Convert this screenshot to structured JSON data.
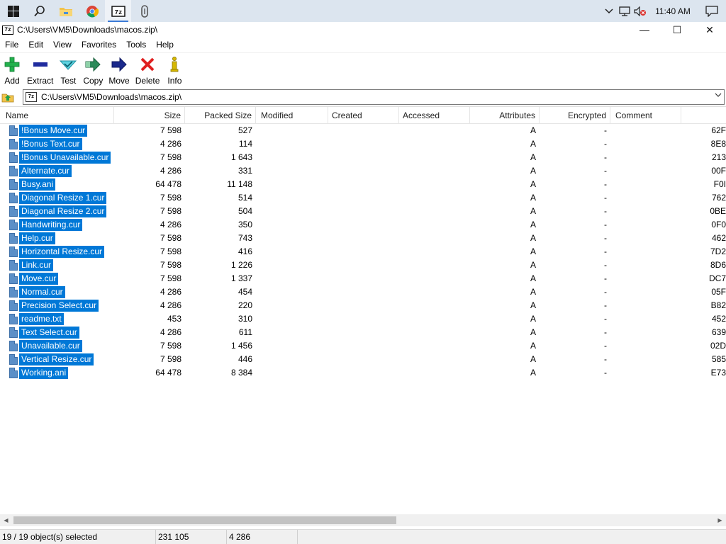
{
  "taskbar": {
    "apps": [
      "windows-start-icon",
      "search-icon",
      "file-explorer-icon",
      "chrome-icon",
      "7zip-icon",
      "paperclip-icon"
    ],
    "clock": "11:40 AM"
  },
  "window": {
    "title": "C:\\Users\\VM5\\Downloads\\macos.zip\\",
    "app_icon_text": "7z",
    "minimize": "—",
    "maximize": "☐",
    "close": "✕"
  },
  "menu": [
    "File",
    "Edit",
    "View",
    "Favorites",
    "Tools",
    "Help"
  ],
  "toolbar": [
    {
      "label": "Add",
      "icon": "add-icon",
      "color": "#22b14c"
    },
    {
      "label": "Extract",
      "icon": "extract-icon",
      "color": "#1f2b9e"
    },
    {
      "label": "Test",
      "icon": "test-icon",
      "color": "#27b5c9"
    },
    {
      "label": "Copy",
      "icon": "copy-icon",
      "color": "#2b8a5a"
    },
    {
      "label": "Move",
      "icon": "move-icon",
      "color": "#1b2a8c"
    },
    {
      "label": "Delete",
      "icon": "delete-icon",
      "color": "#e02020"
    },
    {
      "label": "Info",
      "icon": "info-icon",
      "color": "#d6b800"
    }
  ],
  "address": {
    "icon_text": "7z",
    "path": "C:\\Users\\VM5\\Downloads\\macos.zip\\"
  },
  "columns": [
    "Name",
    "Size",
    "Packed Size",
    "Modified",
    "Created",
    "Accessed",
    "Attributes",
    "Encrypted",
    "Comment",
    ""
  ],
  "files": [
    {
      "name": "!Bonus  Move.cur",
      "size": "7 598",
      "packed": "527",
      "attr": "A",
      "enc": "-",
      "crc": "62F"
    },
    {
      "name": "!Bonus  Text.cur",
      "size": "4 286",
      "packed": "114",
      "attr": "A",
      "enc": "-",
      "crc": "8E8"
    },
    {
      "name": "!Bonus  Unavailable.cur",
      "size": "7 598",
      "packed": "1 643",
      "attr": "A",
      "enc": "-",
      "crc": "213"
    },
    {
      "name": "Alternate.cur",
      "size": "4 286",
      "packed": "331",
      "attr": "A",
      "enc": "-",
      "crc": "00F"
    },
    {
      "name": "Busy.ani",
      "size": "64 478",
      "packed": "11 148",
      "attr": "A",
      "enc": "-",
      "crc": "F0I"
    },
    {
      "name": "Diagonal Resize 1.cur",
      "size": "7 598",
      "packed": "514",
      "attr": "A",
      "enc": "-",
      "crc": "762"
    },
    {
      "name": "Diagonal Resize 2.cur",
      "size": "7 598",
      "packed": "504",
      "attr": "A",
      "enc": "-",
      "crc": "0BE"
    },
    {
      "name": "Handwriting.cur",
      "size": "4 286",
      "packed": "350",
      "attr": "A",
      "enc": "-",
      "crc": "0F0"
    },
    {
      "name": "Help.cur",
      "size": "7 598",
      "packed": "743",
      "attr": "A",
      "enc": "-",
      "crc": "462"
    },
    {
      "name": "Horizontal Resize.cur",
      "size": "7 598",
      "packed": "416",
      "attr": "A",
      "enc": "-",
      "crc": "7D2"
    },
    {
      "name": "Link.cur",
      "size": "7 598",
      "packed": "1 226",
      "attr": "A",
      "enc": "-",
      "crc": "8D6"
    },
    {
      "name": "Move.cur",
      "size": "7 598",
      "packed": "1 337",
      "attr": "A",
      "enc": "-",
      "crc": "DC7"
    },
    {
      "name": "Normal.cur",
      "size": "4 286",
      "packed": "454",
      "attr": "A",
      "enc": "-",
      "crc": "05F"
    },
    {
      "name": "Precision Select.cur",
      "size": "4 286",
      "packed": "220",
      "attr": "A",
      "enc": "-",
      "crc": "B82"
    },
    {
      "name": "readme.txt",
      "size": "453",
      "packed": "310",
      "attr": "A",
      "enc": "-",
      "crc": "452"
    },
    {
      "name": "Text Select.cur",
      "size": "4 286",
      "packed": "611",
      "attr": "A",
      "enc": "-",
      "crc": "639"
    },
    {
      "name": "Unavailable.cur",
      "size": "7 598",
      "packed": "1 456",
      "attr": "A",
      "enc": "-",
      "crc": "02D"
    },
    {
      "name": "Vertical Resize.cur",
      "size": "7 598",
      "packed": "446",
      "attr": "A",
      "enc": "-",
      "crc": "585"
    },
    {
      "name": "Working.ani",
      "size": "64 478",
      "packed": "8 384",
      "attr": "A",
      "enc": "-",
      "crc": "E73"
    }
  ],
  "status": {
    "selected": "19 / 19 object(s) selected",
    "total_size": "231 105",
    "item_size": "4 286"
  },
  "colors": {
    "selection": "#0078d7",
    "taskbar": "#dce5ef"
  }
}
